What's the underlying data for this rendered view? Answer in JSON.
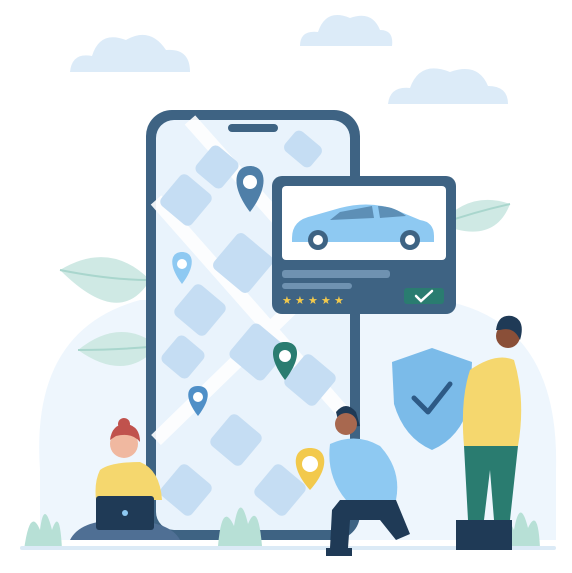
{
  "illustration": {
    "theme": "car-sharing-app-map-navigation",
    "colors": {
      "phone_frame": "#3e6383",
      "map_bg": "#e9f3fc",
      "map_block": "#c5ddf3",
      "card_frame": "#3e6383",
      "car_body": "#8ec9f2",
      "accent_teal": "#2a7c70",
      "pin_blue": "#4f8fc7",
      "pin_yellow": "#f2c94c",
      "shield": "#7bbbe9",
      "leaf": "#cfe9e4",
      "grass": "#b7e0d6",
      "cloud": "#dcebf8",
      "star": "#f2c94c"
    },
    "rating": {
      "stars": 5
    },
    "confirm_icon": "check-icon",
    "icons": [
      "map-pin-icon",
      "car-icon",
      "star-icon",
      "check-icon",
      "shield-icon",
      "laptop-icon",
      "leaf-icon",
      "cloud-icon"
    ]
  }
}
